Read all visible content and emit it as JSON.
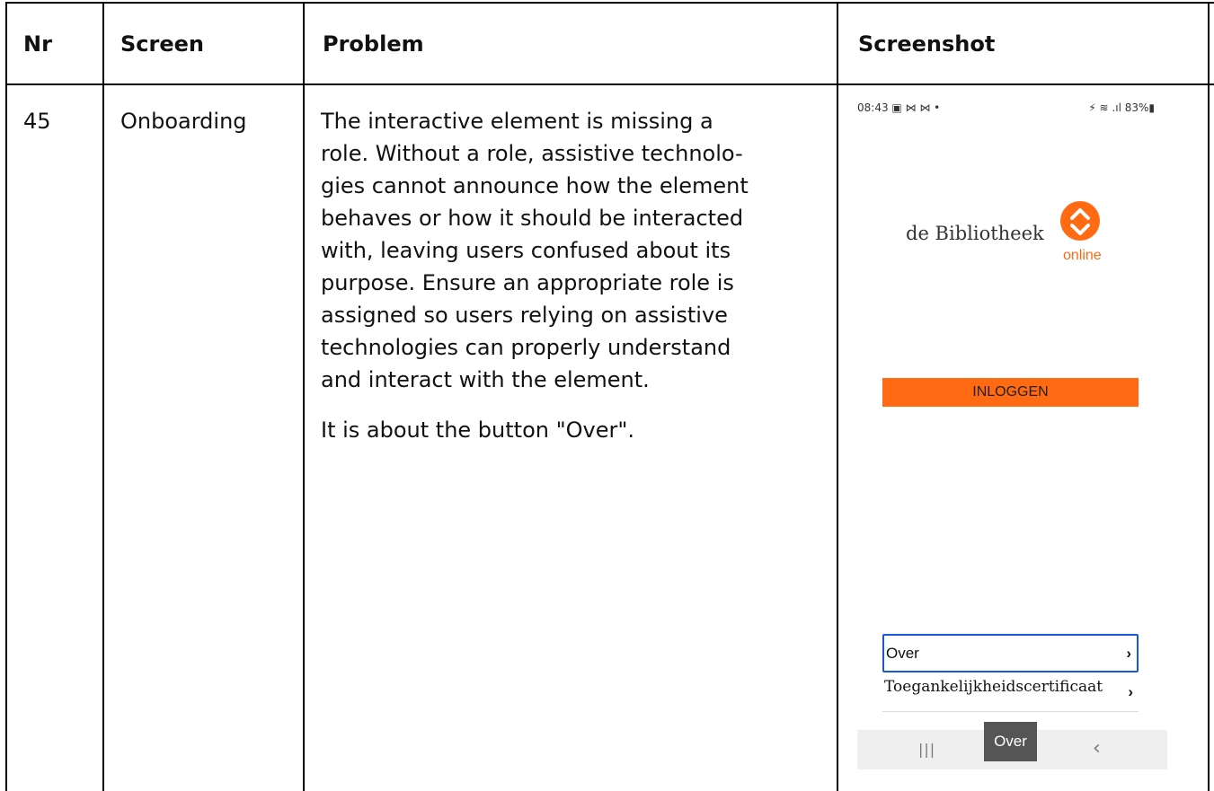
{
  "headers": {
    "nr": "Nr",
    "screen": "Screen",
    "problem": "Problem",
    "screenshot": "Screenshot"
  },
  "row": {
    "nr": "45",
    "screen": "Onboarding",
    "problem_lines": [
      "The interactive element is missing a",
      "role. Without a role, assistive technolo-",
      "gies cannot announce how the element",
      "behaves or how it should be interacted",
      "with, leaving users confused about its",
      "purpose. Ensure an appropriate role is",
      "assigned so users relying on assistive",
      "technologies can properly understand",
      "and interact with the element."
    ],
    "note": "It is about the button \"Over\"."
  },
  "phone": {
    "status_time": "08:43 ▣ ⋈ ⋈ •",
    "status_right": "⚡ ≋ .ıl 83%▮",
    "logo_text": "de Bibliotheek",
    "logo_sub": "online",
    "login_label": "INLOGGEN",
    "menu_over": "Over",
    "menu_toeg": "Toegankelijkheidscertificaat",
    "chevron": "›",
    "tooltip": "Over",
    "nav_recent": "|||",
    "nav_back": "‹",
    "colors": {
      "brand_orange": "#ff6a13",
      "focus_blue": "#1a56db"
    }
  }
}
